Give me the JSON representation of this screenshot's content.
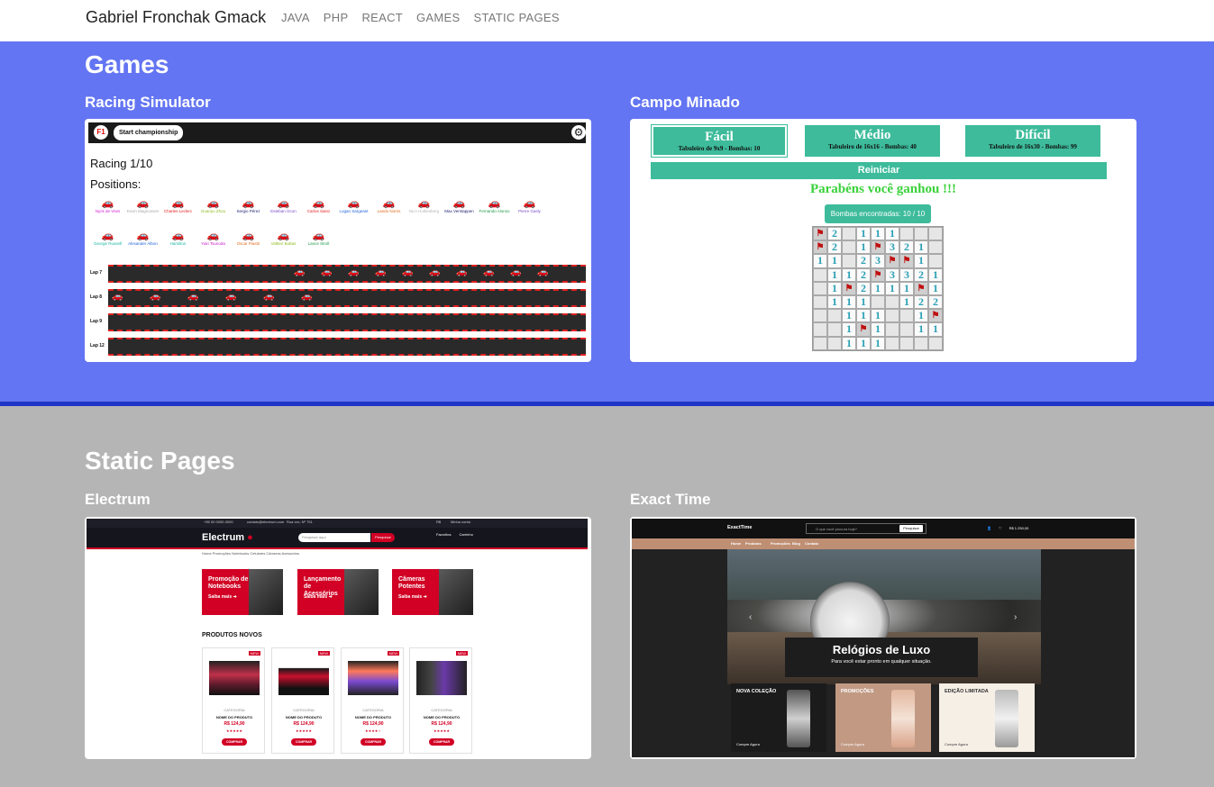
{
  "navbar": {
    "brand": "Gabriel Fronchak Gmack",
    "links": [
      "JAVA",
      "PHP",
      "REACT",
      "GAMES",
      "STATIC PAGES"
    ]
  },
  "games": {
    "title": "Games",
    "racing": {
      "title": "Racing Simulator",
      "champ_button": "Start championship",
      "f1_logo": "F1",
      "racing_label": "Racing 1/10",
      "positions_label": "Positions:",
      "drivers": [
        {
          "name": "Nyck de Vries",
          "color": "#d21bd2"
        },
        {
          "name": "Kevin Magnussen",
          "color": "#aaaaaa"
        },
        {
          "name": "Charles Leclerc",
          "color": "#e21b1b"
        },
        {
          "name": "Guanyu Zhou",
          "color": "#8fbd1f"
        },
        {
          "name": "Sergio Pérez",
          "color": "#1a1f6e"
        },
        {
          "name": "Esteban Ocon",
          "color": "#7b4cc9"
        },
        {
          "name": "Carlos Sainz",
          "color": "#e21b1b"
        },
        {
          "name": "Logan Sargeant",
          "color": "#1f64d9"
        },
        {
          "name": "Lando Norris",
          "color": "#e26a1b"
        },
        {
          "name": "Nico Hulkenberg",
          "color": "#b5b5b5"
        },
        {
          "name": "Max Verstappen",
          "color": "#1a1f6e"
        },
        {
          "name": "Fernando Alonso",
          "color": "#1e9b4a"
        },
        {
          "name": "Pierre Gasly",
          "color": "#7b4cc9"
        },
        {
          "name": "George Russell",
          "color": "#17b5a2"
        },
        {
          "name": "Alexander Albon",
          "color": "#1f64d9"
        },
        {
          "name": "Hamilton",
          "color": "#17b5a2"
        },
        {
          "name": "Yuki Tsunoda",
          "color": "#c918c9"
        },
        {
          "name": "Oscar Piastri",
          "color": "#e26a1b"
        },
        {
          "name": "Valtteri Bottas",
          "color": "#8fbd1f"
        },
        {
          "name": "Lance Stroll",
          "color": "#1e9b4a"
        }
      ],
      "laps": [
        {
          "label": "Lap 7",
          "cars": [
            "#aaaaaa",
            "#e21b1b",
            "#8fbd1f",
            "#1a1f6e",
            "#7b4cc9",
            "#e21b1b",
            "#1f64d9",
            "#e26a1b",
            "#e21b1b",
            "#1e9b4a"
          ]
        },
        {
          "label": "Lap 8",
          "cars": [
            "#17b5a2",
            "#1f64d9",
            "#17b5a2",
            "#c918c9",
            "#8fbd1f",
            "#1e9b4a"
          ]
        },
        {
          "label": "Lap 9",
          "cars": []
        },
        {
          "label": "Lap 12",
          "cars": []
        }
      ]
    },
    "minesweeper": {
      "title": "Campo Minado",
      "difficulties": [
        {
          "name": "Fácil",
          "desc": "Tabuleiro de 9x9 - Bombas: 10"
        },
        {
          "name": "Médio",
          "desc": "Tabuleiro de 16x16 - Bombas: 40"
        },
        {
          "name": "Difícil",
          "desc": "Tabuleiro de 16x30 - Bombas: 99"
        }
      ],
      "restart": "Reiniciar",
      "win_message": "Parabéns você ganhou !!!",
      "bombs_found": "Bombas encontradas: 10 / 10",
      "grid": [
        [
          "F",
          "2",
          "",
          "1",
          "1",
          "1",
          "",
          "",
          ""
        ],
        [
          "F",
          "2",
          "",
          "1",
          "F",
          "3",
          "2",
          "1",
          ""
        ],
        [
          "1",
          "1",
          "",
          "2",
          "3",
          "F",
          "F",
          "1",
          ""
        ],
        [
          "",
          "1",
          "1",
          "2",
          "F",
          "3",
          "3",
          "2",
          "1"
        ],
        [
          "",
          "1",
          "F",
          "2",
          "1",
          "1",
          "1",
          "F",
          "1"
        ],
        [
          "",
          "1",
          "1",
          "1",
          "",
          "",
          "1",
          "2",
          "2"
        ],
        [
          "",
          "",
          "1",
          "1",
          "1",
          "",
          "",
          "1",
          "F"
        ],
        [
          "",
          "",
          "1",
          "F",
          "1",
          "",
          "",
          "1",
          "1"
        ],
        [
          "",
          "",
          "1",
          "1",
          "1",
          "",
          "",
          "",
          ""
        ]
      ]
    }
  },
  "static_pages": {
    "title": "Static Pages",
    "electrum": {
      "title": "Electrum",
      "topbar": [
        "+55 00 0000-0000",
        "contato@electrum.com",
        "Rua xxx, Nº 751",
        "R$",
        "Minha conta"
      ],
      "logo": "Electrum",
      "search_placeholder": "Pesquisar aqui",
      "search_button": "Pesquisar",
      "header_icons": [
        "Favoritos",
        "Carrinho"
      ],
      "nav": "Home   Promoções   Notebooks   Celulares   Câmeras   Acessórios",
      "promos": [
        {
          "title": "Promoção de Notebooks",
          "link": "Saiba mais ➜"
        },
        {
          "title": "Lançamento de Acessórios",
          "link": "Saiba mais ➜"
        },
        {
          "title": "Câmeras Potentes",
          "link": "Saiba mais ➜"
        }
      ],
      "products_title": "PRODUTOS NOVOS",
      "products": [
        {
          "badge": "NEW",
          "category": "CATEGORIA",
          "name": "NOME DO PRODUTO",
          "price": "R$ 124,90",
          "stars": "★★★★★",
          "button": "COMPRAR"
        },
        {
          "badge": "NEW",
          "category": "CATEGORIA",
          "name": "NOME DO PRODUTO",
          "price": "R$ 124,90",
          "stars": "★★★★★",
          "button": "COMPRAR"
        },
        {
          "badge": "NEW",
          "category": "CATEGORIA",
          "name": "NOME DO PRODUTO",
          "price": "R$ 124,90",
          "stars": "★★★★☆",
          "button": "COMPRAR"
        },
        {
          "badge": "NEW",
          "category": "CATEGORIA",
          "name": "NOME DO PRODUTO",
          "price": "R$ 124,90",
          "stars": "★★★★★",
          "button": "COMPRAR"
        }
      ]
    },
    "exacttime": {
      "title": "Exact Time",
      "logo": "ExactTime",
      "search_placeholder": "O que você procura hoje?",
      "search_button": "Pesquisar",
      "cart_total": "R$ 1.250,00",
      "menu": [
        "Home",
        "Produtos",
        "Promoções",
        "Blog",
        "Contato"
      ],
      "hero_title": "Relógios de Luxo",
      "hero_subtitle": "Para você estar pronto em qualquer situação.",
      "categories": [
        {
          "title": "NOVA COLEÇÃO",
          "button": "Compre Agora",
          "bg": "#1b1b1b",
          "fg": "#ffffff"
        },
        {
          "title": "PROMOÇÕES",
          "button": "Compre Agora",
          "bg": "#c29a84",
          "fg": "#ffffff"
        },
        {
          "title": "EDIÇÃO LIMITADA",
          "button": "Compre Agora",
          "bg": "#f6efe6",
          "fg": "#333333"
        }
      ]
    }
  }
}
